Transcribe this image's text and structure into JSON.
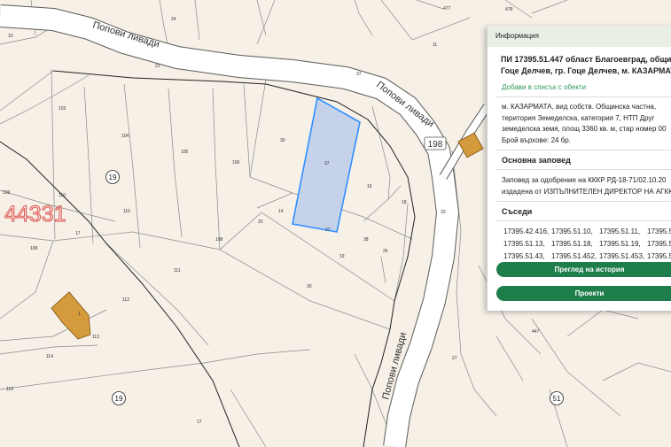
{
  "map": {
    "road_labels": [
      "Попови ливади",
      "Попови ливади",
      "Попови ливади"
    ],
    "road_badge": "198",
    "zone_label": "44331",
    "circle_labels": [
      "19",
      "19",
      "51"
    ],
    "parcel_numbers": [
      "24",
      "21",
      "10",
      "11",
      "37",
      "477",
      "478",
      "103",
      "104",
      "105",
      "106",
      "14",
      "30",
      "37",
      "16",
      "18",
      "27",
      "38",
      "19",
      "30",
      "109",
      "110",
      "112",
      "111",
      "108",
      "20",
      "26",
      "108",
      "17",
      "113",
      "116",
      "114",
      "115",
      "1",
      "17",
      "27",
      "447",
      "20"
    ]
  },
  "panel": {
    "header": "Информация",
    "title_line1": "ПИ 17395.51.447 област Благоевград, община",
    "title_line2": "Гоце Делчев, гр. Гоце Делчев, м. КАЗАРМАТА",
    "add_to_list": "Добави в списък с обекти",
    "desc_line1": "м.  КАЗАРМАТА,  вид  собств.  Общинска  частна,",
    "desc_line2": "територия  Земеделска,  категория  7,  НТП  Друг",
    "desc_line3": "земеделска земя, площ 3360 кв. м, стар номер 00",
    "desc_line4": "Брой върхове: 24 бр.",
    "order_heading": "Основна заповед",
    "order_line1": "Заповед  за  одобрение  на  КККР  РД-18-71/02.10.20",
    "order_line2": "издадена от ИЗПЪЛНИТЕЛЕН ДИРЕКТОР НА АГКК",
    "neighbors_heading": "Съседи",
    "neighbors": [
      [
        "17395.42.416,",
        "17395.51.10,",
        "17395.51.11,",
        "17395.5"
      ],
      [
        "17395.51.13,",
        "17395.51.18,",
        "17395.51.19,",
        "17395.51"
      ],
      [
        "17395.51.43,",
        "17395.51.452,",
        "17395.51.453,",
        "17395.51.4"
      ]
    ],
    "history_button": "Преглед на история",
    "projects_button": "Проекти"
  },
  "colors": {
    "map_background": "#f6f0e6",
    "parcel_line": "#8a8a8a",
    "road_fill": "#ffffff",
    "selected_fill": "#c5d2ea",
    "selected_stroke": "#2f8fff",
    "building_fill": "#d59a3c",
    "panel_header_bg": "#e9efe4",
    "button_bg": "#1e7e4b",
    "link_color": "#2e9a5a",
    "zone_label_color": "#e05050"
  }
}
